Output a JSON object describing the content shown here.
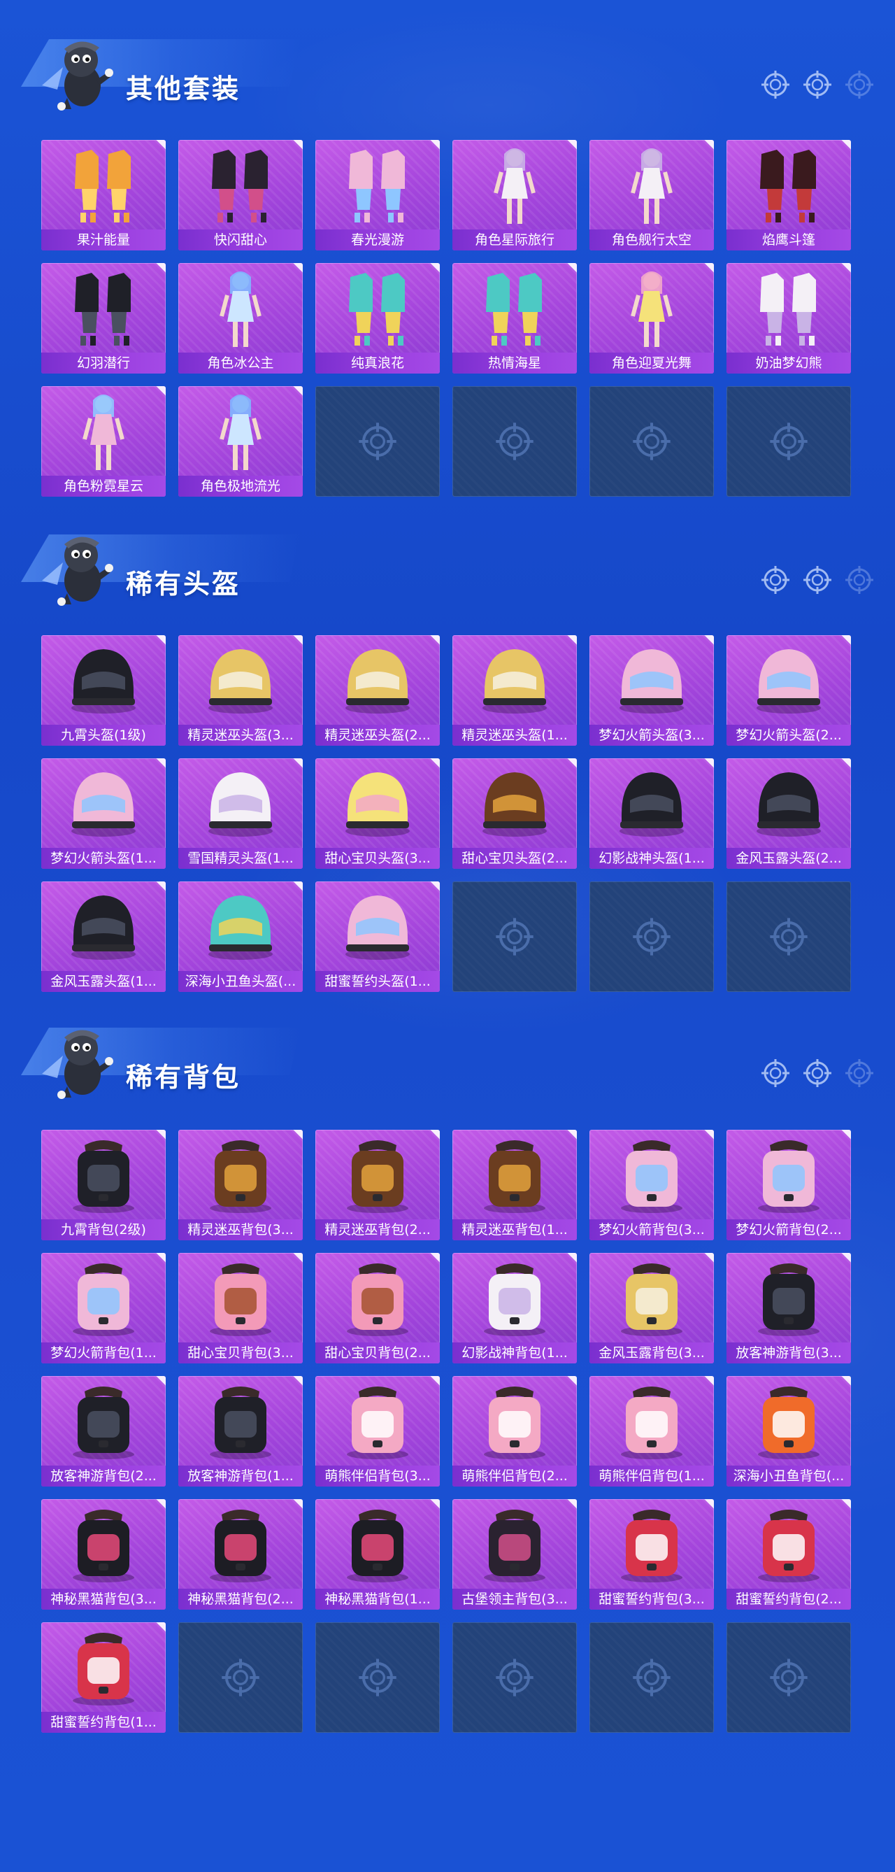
{
  "colors": {
    "background": "#1a4fd1",
    "tile_purple": "#a445dc",
    "tile_label": "#8a36d8",
    "empty_slot": "#23437a",
    "text": "#ffffff"
  },
  "sections": [
    {
      "title": "其他套装",
      "items": [
        {
          "label": "果汁能量",
          "art": "outfit-orange"
        },
        {
          "label": "快闪甜心",
          "art": "outfit-dark"
        },
        {
          "label": "春光漫游",
          "art": "outfit-pink"
        },
        {
          "label": "角色星际旅行",
          "art": "character-white"
        },
        {
          "label": "角色舰行太空",
          "art": "character-white"
        },
        {
          "label": "焰鹰斗篷",
          "art": "outfit-red"
        },
        {
          "label": "幻羽潜行",
          "art": "outfit-black"
        },
        {
          "label": "角色冰公主",
          "art": "character-blue"
        },
        {
          "label": "纯真浪花",
          "art": "outfit-teal"
        },
        {
          "label": "热情海星",
          "art": "outfit-teal"
        },
        {
          "label": "角色迎夏光舞",
          "art": "character-yellow"
        },
        {
          "label": "奶油梦幻熊",
          "art": "outfit-white"
        },
        {
          "label": "角色粉霓星云",
          "art": "character-pink"
        },
        {
          "label": "角色极地流光",
          "art": "character-blue"
        }
      ],
      "empty_slots": 4
    },
    {
      "title": "稀有头盔",
      "items": [
        {
          "label": "九霄头盔(1级)",
          "art": "helmet-black"
        },
        {
          "label": "精灵迷巫头盔(3...",
          "art": "helmet-gold"
        },
        {
          "label": "精灵迷巫头盔(2...",
          "art": "helmet-gold"
        },
        {
          "label": "精灵迷巫头盔(1...",
          "art": "helmet-gold"
        },
        {
          "label": "梦幻火箭头盔(3...",
          "art": "helmet-pink"
        },
        {
          "label": "梦幻火箭头盔(2...",
          "art": "helmet-pink"
        },
        {
          "label": "梦幻火箭头盔(1...",
          "art": "helmet-pink"
        },
        {
          "label": "雪国精灵头盔(1...",
          "art": "helmet-white"
        },
        {
          "label": "甜心宝贝头盔(3...",
          "art": "helmet-yellow"
        },
        {
          "label": "甜心宝贝头盔(2...",
          "art": "helmet-brown"
        },
        {
          "label": "幻影战神头盔(1...",
          "art": "helmet-black"
        },
        {
          "label": "金风玉露头盔(2...",
          "art": "helmet-black"
        },
        {
          "label": "金风玉露头盔(1...",
          "art": "helmet-black"
        },
        {
          "label": "深海小丑鱼头盔(...",
          "art": "helmet-teal"
        },
        {
          "label": "甜蜜誓约头盔(1...",
          "art": "helmet-pink"
        }
      ],
      "empty_slots": 3
    },
    {
      "title": "稀有背包",
      "items": [
        {
          "label": "九霄背包(2级)",
          "art": "backpack-black"
        },
        {
          "label": "精灵迷巫背包(3...",
          "art": "backpack-brown"
        },
        {
          "label": "精灵迷巫背包(2...",
          "art": "backpack-brown"
        },
        {
          "label": "精灵迷巫背包(1...",
          "art": "backpack-brown"
        },
        {
          "label": "梦幻火箭背包(3...",
          "art": "backpack-pink"
        },
        {
          "label": "梦幻火箭背包(2...",
          "art": "backpack-pink"
        },
        {
          "label": "梦幻火箭背包(1...",
          "art": "backpack-pink"
        },
        {
          "label": "甜心宝贝背包(3...",
          "art": "backpack-cake"
        },
        {
          "label": "甜心宝贝背包(2...",
          "art": "backpack-cake"
        },
        {
          "label": "幻影战神背包(1...",
          "art": "backpack-white"
        },
        {
          "label": "金风玉露背包(3...",
          "art": "backpack-gold"
        },
        {
          "label": "放客神游背包(3...",
          "art": "backpack-bear-black"
        },
        {
          "label": "放客神游背包(2...",
          "art": "backpack-bear-black"
        },
        {
          "label": "放客神游背包(1...",
          "art": "backpack-bear-black"
        },
        {
          "label": "萌熊伴侣背包(3...",
          "art": "backpack-bear-pink"
        },
        {
          "label": "萌熊伴侣背包(2...",
          "art": "backpack-bear-pink"
        },
        {
          "label": "萌熊伴侣背包(1...",
          "art": "backpack-bear-pink"
        },
        {
          "label": "深海小丑鱼背包(...",
          "art": "backpack-fish"
        },
        {
          "label": "神秘黑猫背包(3...",
          "art": "backpack-cat"
        },
        {
          "label": "神秘黑猫背包(2...",
          "art": "backpack-cat"
        },
        {
          "label": "神秘黑猫背包(1...",
          "art": "backpack-cat"
        },
        {
          "label": "古堡领主背包(3...",
          "art": "backpack-dark"
        },
        {
          "label": "甜蜜誓约背包(3...",
          "art": "backpack-heart"
        },
        {
          "label": "甜蜜誓约背包(2...",
          "art": "backpack-heart"
        },
        {
          "label": "甜蜜誓约背包(1...",
          "art": "backpack-heart"
        }
      ],
      "empty_slots": 5
    }
  ]
}
